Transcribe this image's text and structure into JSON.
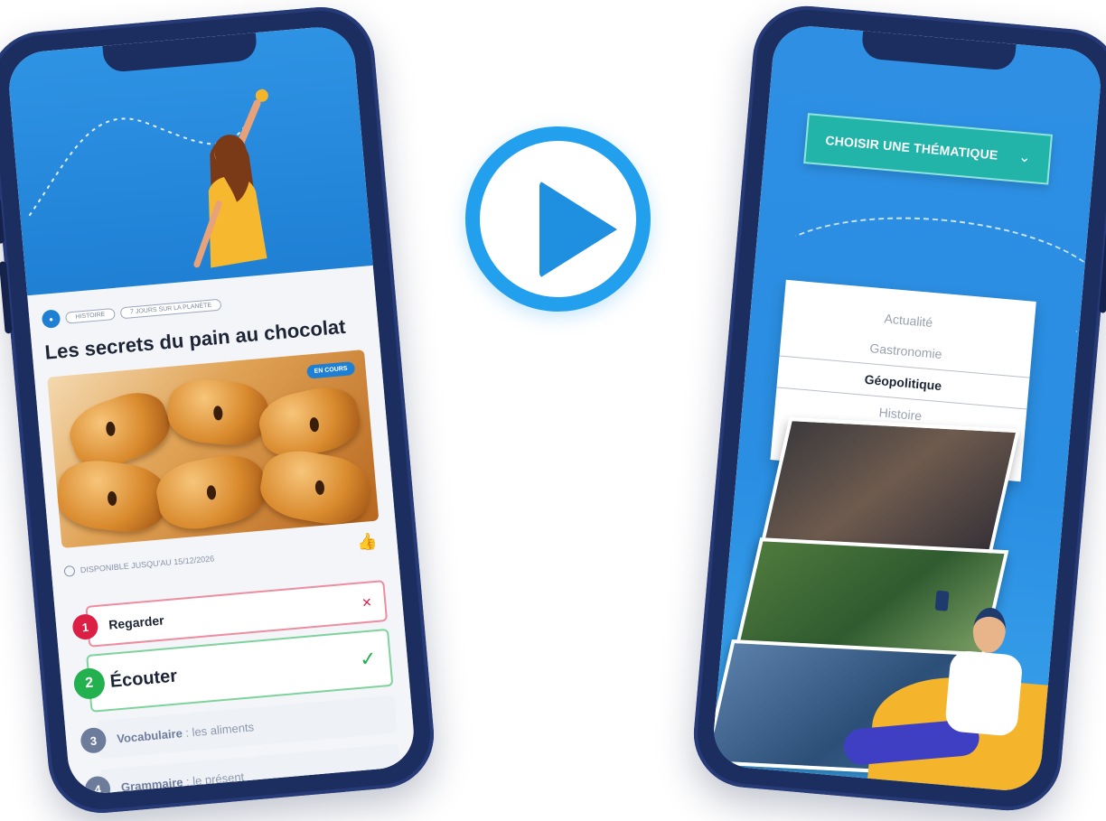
{
  "left_phone": {
    "tags": [
      "HISTOIRE",
      "7 JOURS SUR LA PLANÈTE"
    ],
    "title": "Les secrets du pain au chocolat",
    "badge": "EN COURS",
    "availability": "DISPONIBLE JUSQU'AU 15/12/2026",
    "steps": [
      {
        "num": "1",
        "label": "Regarder",
        "status": "×"
      },
      {
        "num": "2",
        "label": "Écouter",
        "status": "✓"
      },
      {
        "num": "3",
        "label": "Vocabulaire",
        "detail": " : les aliments"
      },
      {
        "num": "4",
        "label": "Grammaire",
        "detail": " : le présent"
      }
    ]
  },
  "right_phone": {
    "select_label": "CHOISIR UNE THÉMATIQUE",
    "options": [
      "Actualité",
      "Gastronomie",
      "Géopolitique",
      "Histoire"
    ],
    "selected_option": "Géopolitique"
  },
  "colors": {
    "primary_blue": "#2f93e4",
    "navy": "#1c2d60",
    "teal": "#22b4a8",
    "error_red": "#dc1f45",
    "success_green": "#23b04e"
  }
}
